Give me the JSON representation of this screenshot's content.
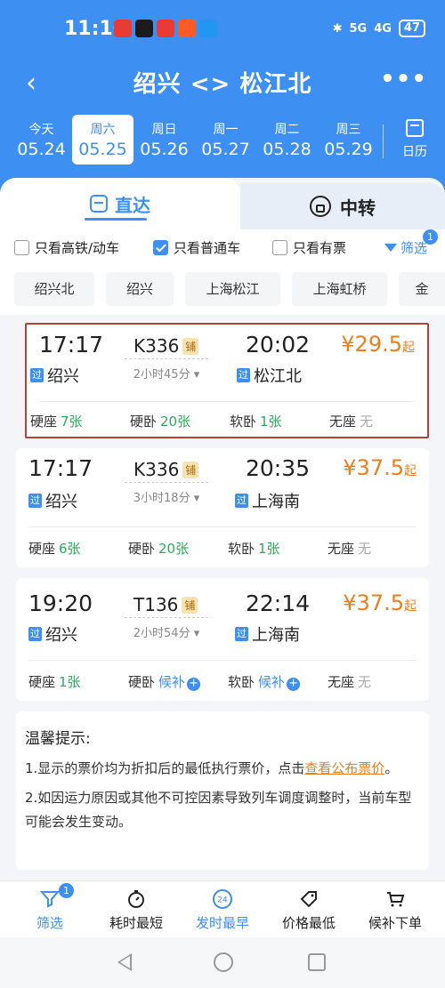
{
  "status": {
    "time": "11:10",
    "network1": "5G",
    "network2": "4G",
    "battery": "47"
  },
  "nav": {
    "title": "绍兴 <> 松江北",
    "back_icon": "back-arrow-icon",
    "more_icon": "more-dots-icon"
  },
  "dates": [
    {
      "weekday": "今天",
      "date": "05.24"
    },
    {
      "weekday": "周六",
      "date": "05.25",
      "selected": true
    },
    {
      "weekday": "周日",
      "date": "05.26"
    },
    {
      "weekday": "周一",
      "date": "05.27"
    },
    {
      "weekday": "周二",
      "date": "05.28"
    },
    {
      "weekday": "周三",
      "date": "05.29"
    }
  ],
  "calendar_label": "日历",
  "tabs": {
    "direct": "直达",
    "transfer": "中转"
  },
  "filters": {
    "highspeed": "只看高铁/动车",
    "normal": "只看普通车",
    "available": "只看有票",
    "filter_btn": "筛选",
    "filter_badge": "1"
  },
  "stations": [
    "绍兴北",
    "绍兴",
    "上海松江",
    "上海虹桥",
    "金"
  ],
  "trains": [
    {
      "dep_time": "17:17",
      "train_no": "K336",
      "tag": "铺",
      "duration": "2小时45分",
      "arr_time": "20:02",
      "price": "¥29.5",
      "price_suffix": "起",
      "pass_tag": "过",
      "from": "绍兴",
      "to": "松江北",
      "seats": [
        {
          "type": "硬座",
          "count": "7张"
        },
        {
          "type": "硬卧",
          "count": "20张"
        },
        {
          "type": "软卧",
          "count": "1张"
        },
        {
          "type": "无座",
          "count": "无"
        }
      ]
    },
    {
      "dep_time": "17:17",
      "train_no": "K336",
      "tag": "铺",
      "duration": "3小时18分",
      "arr_time": "20:35",
      "price": "¥37.5",
      "price_suffix": "起",
      "pass_tag": "过",
      "from": "绍兴",
      "to": "上海南",
      "seats": [
        {
          "type": "硬座",
          "count": "6张"
        },
        {
          "type": "硬卧",
          "count": "20张"
        },
        {
          "type": "软卧",
          "count": "1张"
        },
        {
          "type": "无座",
          "count": "无"
        }
      ]
    },
    {
      "dep_time": "19:20",
      "train_no": "T136",
      "tag": "铺",
      "duration": "2小时54分",
      "arr_time": "22:14",
      "price": "¥37.5",
      "price_suffix": "起",
      "pass_tag": "过",
      "from": "绍兴",
      "to": "上海南",
      "seats": [
        {
          "type": "硬座",
          "count": "1张"
        },
        {
          "type": "硬卧",
          "count": "候补"
        },
        {
          "type": "软卧",
          "count": "候补"
        },
        {
          "type": "无座",
          "count": "无"
        }
      ]
    }
  ],
  "notice": {
    "title": "温馨提示:",
    "line1_prefix": "1.显示的票价均为折扣后的最低执行票价，点击",
    "line1_link": "查看公布票价",
    "line1_suffix": "。",
    "line2": "2.如因运力原因或其他不可控因素导致列车调度调整时，当前车型可能会发生变动。"
  },
  "bottom": {
    "filter": "筛选",
    "filter_badge": "1",
    "shortest": "耗时最短",
    "earliest": "发时最早",
    "cheapest": "价格最低",
    "waitlist": "候补下单",
    "earliest_icon_text": "24"
  },
  "colors": {
    "brand": "#3d8ff2",
    "price": "#f07d1a",
    "available": "#2bab59"
  }
}
